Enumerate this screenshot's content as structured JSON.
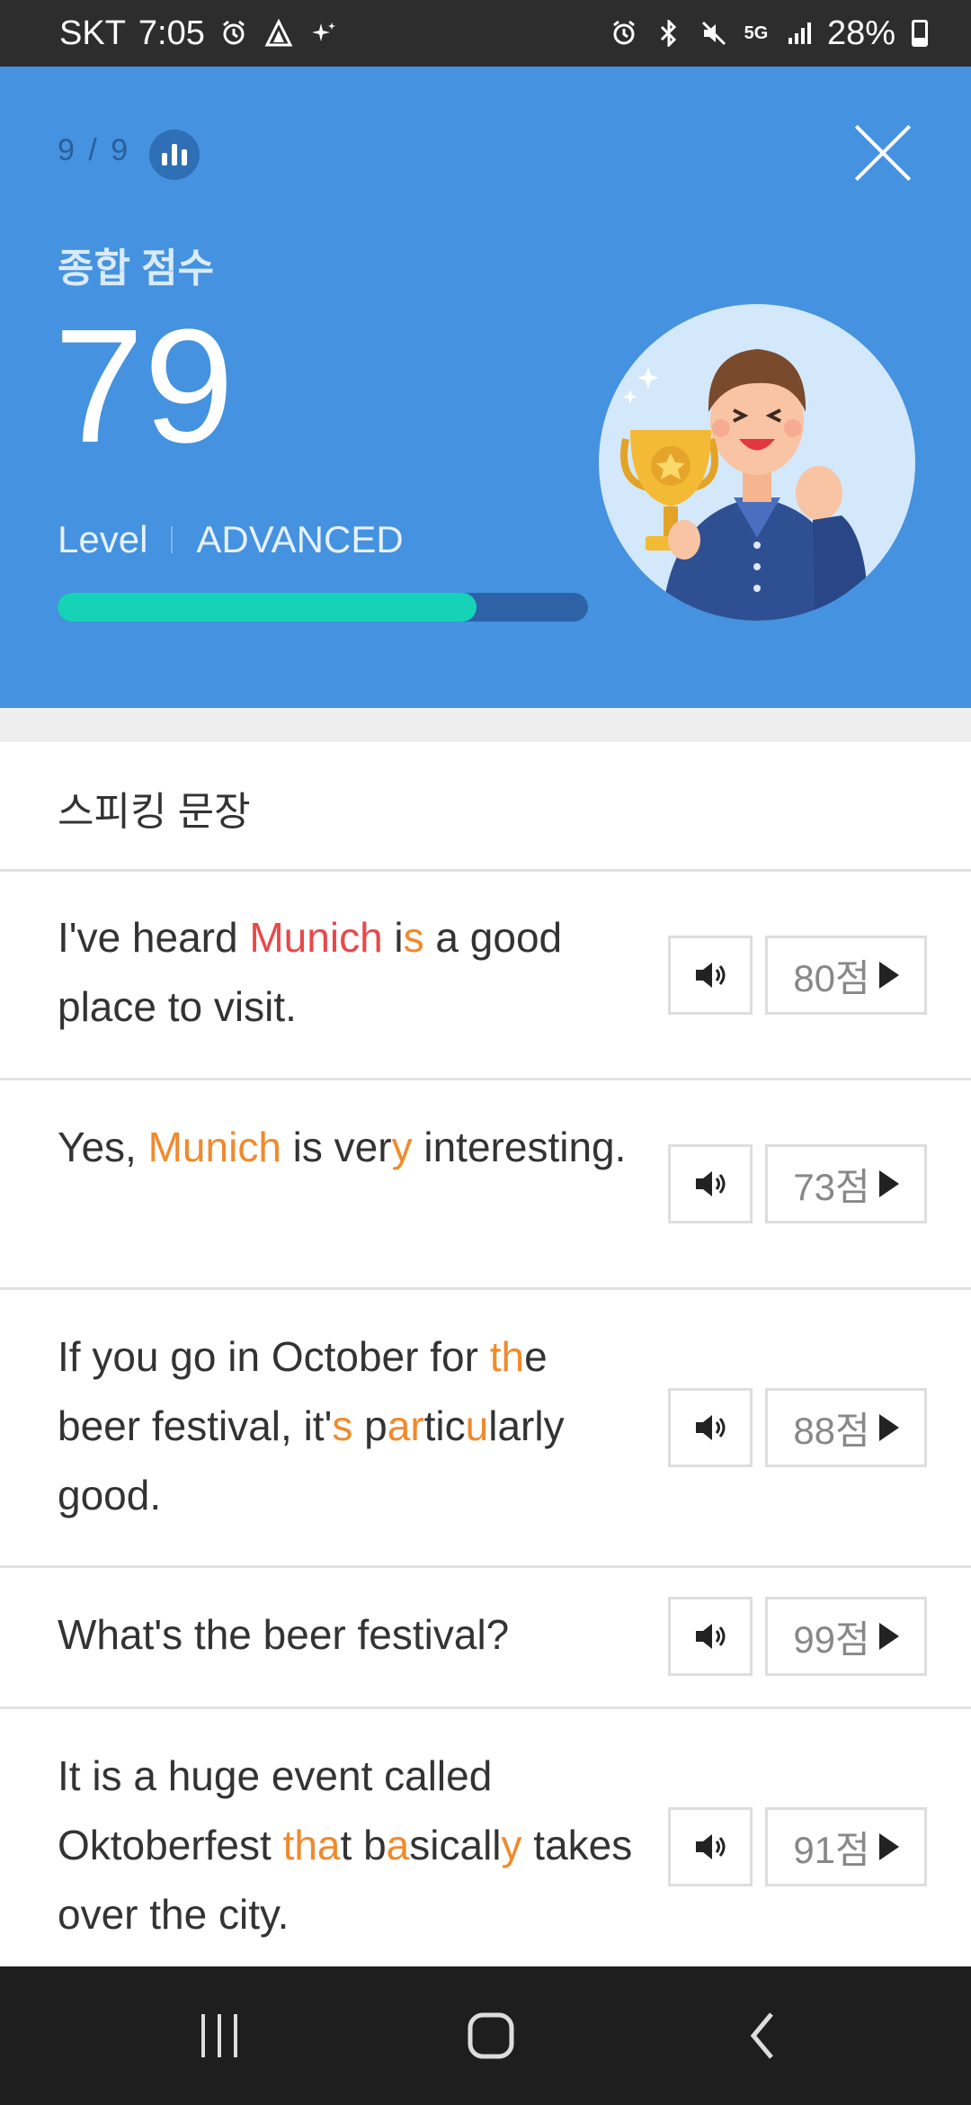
{
  "status_bar": {
    "carrier": "SKT",
    "time": "7:05",
    "network": "5G",
    "battery": "28%",
    "icons": [
      "alarm-icon",
      "navigation-icon",
      "sparkle-icon",
      "alarm-icon",
      "bluetooth-icon",
      "mute-icon",
      "signal-icon",
      "battery-icon"
    ]
  },
  "header": {
    "progress": "9 / 9",
    "score_label": "종합 점수",
    "score": "79",
    "level_label": "Level",
    "level_value": "ADVANCED",
    "level_progress": 0.79,
    "colors": {
      "background": "#4492e0",
      "progress_fill": "#16d3b7",
      "progress_track": "#2d63a6"
    }
  },
  "section": {
    "title": "스피킹 문장",
    "sentences": [
      {
        "segments": [
          {
            "t": "I've heard ",
            "c": ""
          },
          {
            "t": "Munich",
            "c": "red"
          },
          {
            "t": " i",
            "c": ""
          },
          {
            "t": "s",
            "c": "orange"
          },
          {
            "t": " a good place to visit.",
            "c": ""
          }
        ],
        "score": "80점"
      },
      {
        "segments": [
          {
            "t": "Yes, ",
            "c": ""
          },
          {
            "t": "Munich",
            "c": "orange"
          },
          {
            "t": " is ver",
            "c": ""
          },
          {
            "t": "y",
            "c": "orange"
          },
          {
            "t": " interesting.",
            "c": ""
          }
        ],
        "score": "73점"
      },
      {
        "segments": [
          {
            "t": "If you go in October for ",
            "c": ""
          },
          {
            "t": "th",
            "c": "orange"
          },
          {
            "t": "e beer festival, it'",
            "c": ""
          },
          {
            "t": "s",
            "c": "orange"
          },
          {
            "t": " p",
            "c": ""
          },
          {
            "t": "ar",
            "c": "orange"
          },
          {
            "t": "tic",
            "c": ""
          },
          {
            "t": "u",
            "c": "orange"
          },
          {
            "t": "larly good.",
            "c": ""
          }
        ],
        "score": "88점"
      },
      {
        "segments": [
          {
            "t": "What's the beer festival?",
            "c": ""
          }
        ],
        "score": "99점"
      },
      {
        "segments": [
          {
            "t": "It is a huge event called Oktoberfest ",
            "c": ""
          },
          {
            "t": "tha",
            "c": "orange"
          },
          {
            "t": "t b",
            "c": ""
          },
          {
            "t": "a",
            "c": "orange"
          },
          {
            "t": "sicall",
            "c": ""
          },
          {
            "t": "y",
            "c": "orange"
          },
          {
            "t": " takes over the city.",
            "c": ""
          }
        ],
        "score": "91점"
      }
    ]
  },
  "nav_bar": {
    "icons": [
      "recent-apps-icon",
      "home-icon",
      "back-icon"
    ]
  }
}
